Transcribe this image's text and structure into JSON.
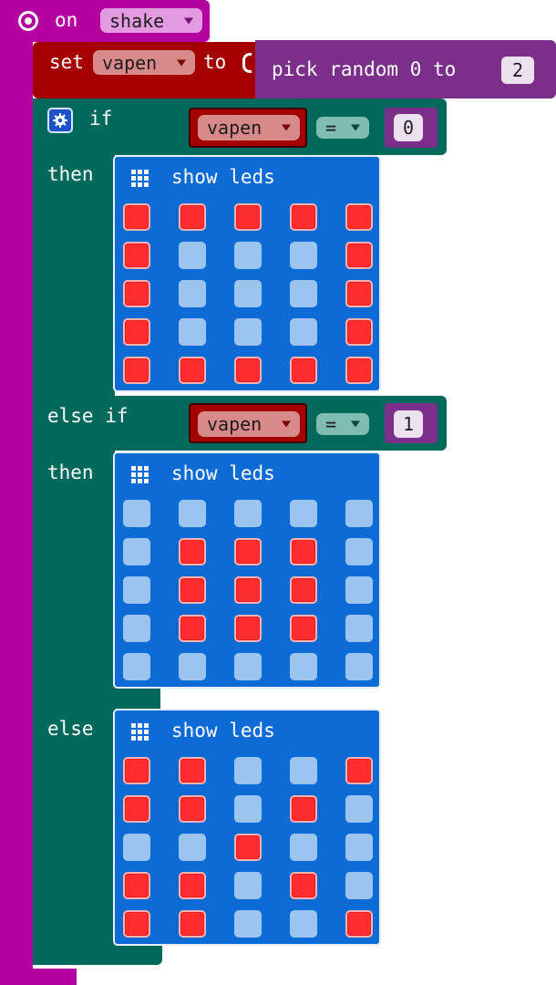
{
  "event": {
    "on_label": "on",
    "gesture": "shake"
  },
  "set_block": {
    "set_label": "set",
    "variable": "vapen",
    "to_label": "to"
  },
  "random_block": {
    "label": "pick random 0 to",
    "max": "2"
  },
  "if_block": {
    "if_label": "if",
    "then_label": "then",
    "else_if_label": "else if",
    "else_label": "else",
    "conditions": [
      {
        "variable": "vapen",
        "operator": "=",
        "value": "0"
      },
      {
        "variable": "vapen",
        "operator": "=",
        "value": "1"
      }
    ]
  },
  "led_blocks": [
    {
      "label": "show leds",
      "grid": [
        [
          1,
          1,
          1,
          1,
          1
        ],
        [
          1,
          0,
          0,
          0,
          1
        ],
        [
          1,
          0,
          0,
          0,
          1
        ],
        [
          1,
          0,
          0,
          0,
          1
        ],
        [
          1,
          1,
          1,
          1,
          1
        ]
      ]
    },
    {
      "label": "show leds",
      "grid": [
        [
          0,
          0,
          0,
          0,
          0
        ],
        [
          0,
          1,
          1,
          1,
          0
        ],
        [
          0,
          1,
          1,
          1,
          0
        ],
        [
          0,
          1,
          1,
          1,
          0
        ],
        [
          0,
          0,
          0,
          0,
          0
        ]
      ]
    },
    {
      "label": "show leds",
      "grid": [
        [
          1,
          1,
          0,
          0,
          1
        ],
        [
          1,
          1,
          0,
          1,
          0
        ],
        [
          0,
          0,
          1,
          0,
          0
        ],
        [
          1,
          1,
          0,
          1,
          0
        ],
        [
          1,
          1,
          0,
          0,
          1
        ]
      ]
    }
  ],
  "colors": {
    "event": "#b4009e",
    "logic": "#00695c",
    "variable": "#a40000",
    "math": "#7b2f8a",
    "basic": "#0d6bd6",
    "led_on": "#ff2d2d",
    "led_off": "#9bc4ef"
  }
}
